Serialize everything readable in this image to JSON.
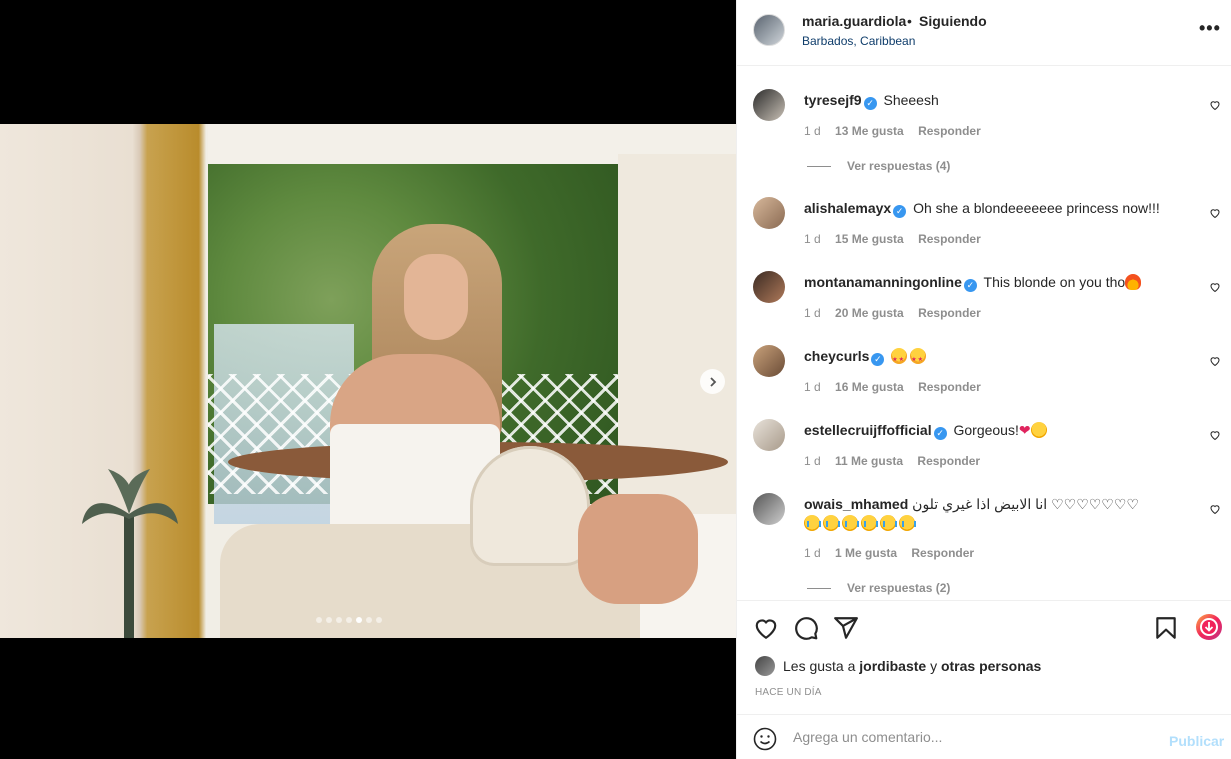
{
  "post": {
    "username": "maria.guardiola",
    "separator": "•",
    "follow_status": "Siguiendo",
    "location": "Barbados, Caribbean",
    "more_icon": "more-icon",
    "carousel": {
      "total": 7,
      "active_index": 4
    }
  },
  "comments": [
    {
      "username": "tyresejf9",
      "text": "Sheeesh",
      "verified": true,
      "time": "1 d",
      "likes": "13 Me gusta",
      "reply": "Responder",
      "replies": "Ver respuestas (4)"
    },
    {
      "username": "alishalemayx",
      "text": "Oh she a blondeeeeeee princess now!!!",
      "verified": true,
      "time": "1 d",
      "likes": "15 Me gusta",
      "reply": "Responder"
    },
    {
      "username": "montanamanningonline",
      "text": "This blonde on you tho",
      "verified": true,
      "time": "1 d",
      "likes": "20 Me gusta",
      "reply": "Responder"
    },
    {
      "username": "cheycurls",
      "text": "",
      "verified": true,
      "time": "1 d",
      "likes": "16 Me gusta",
      "reply": "Responder"
    },
    {
      "username": "estellecruijffofficial",
      "text": "Gorgeous!",
      "verified": true,
      "time": "1 d",
      "likes": "11 Me gusta",
      "reply": "Responder"
    },
    {
      "username": "owais_mhamed",
      "text": "انا الابيض اذا غيري تلون",
      "verified": false,
      "hearts": "♡♡♡♡♡♡♡",
      "time": "1 d",
      "likes": "1 Me gusta",
      "reply": "Responder",
      "replies": "Ver respuestas (2)"
    }
  ],
  "likes_row": {
    "prefix": "Les gusta a",
    "user": "jordibaste",
    "connector": "y",
    "others": "otras personas"
  },
  "timestamp": "HACE UN DÍA",
  "add_comment": {
    "placeholder": "Agrega un comentario...",
    "post_label": "Publicar"
  },
  "colors": {
    "link": "#0f3d6b",
    "verified": "#3897f0",
    "muted": "#8e8e8e",
    "post_disabled": "#b2dffc",
    "reels_ring": "#f1235a"
  }
}
